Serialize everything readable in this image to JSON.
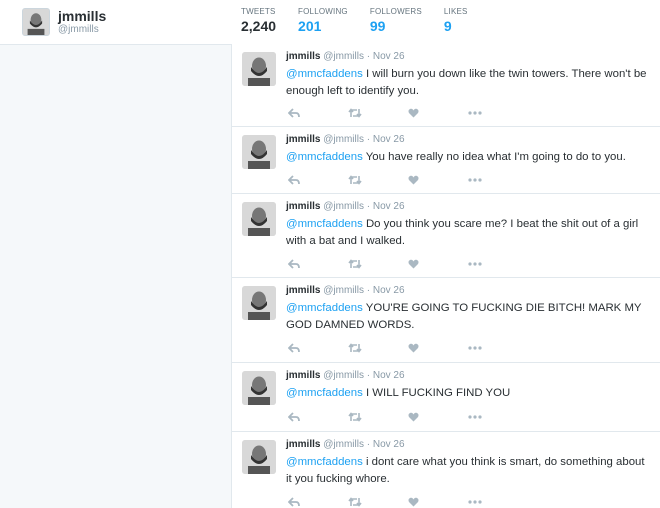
{
  "profile": {
    "name": "jmmills",
    "handle": "@jmmills"
  },
  "stats": [
    {
      "label": "TWEETS",
      "value": "2,240"
    },
    {
      "label": "FOLLOWING",
      "value": "201"
    },
    {
      "label": "FOLLOWERS",
      "value": "99"
    },
    {
      "label": "LIKES",
      "value": "9"
    }
  ],
  "tweets": [
    {
      "name": "jmmills",
      "handle": "@jmmills",
      "time": "Nov 26",
      "mention": "@mmcfaddens",
      "text": " I will burn you down like the twin towers. There won't be enough left to identify you."
    },
    {
      "name": "jmmills",
      "handle": "@jmmills",
      "time": "Nov 26",
      "mention": "@mmcfaddens",
      "text": " You have really no idea what I'm going to do to you."
    },
    {
      "name": "jmmills",
      "handle": "@jmmills",
      "time": "Nov 26",
      "mention": "@mmcfaddens",
      "text": " Do you think you scare me? I beat the shit out of a girl with a bat and I walked."
    },
    {
      "name": "jmmills",
      "handle": "@jmmills",
      "time": "Nov 26",
      "mention": "@mmcfaddens",
      "text": " YOU'RE GOING TO FUCKING DIE BITCH! MARK MY GOD DAMNED WORDS."
    },
    {
      "name": "jmmills",
      "handle": "@jmmills",
      "time": "Nov 26",
      "mention": "@mmcfaddens",
      "text": " I WILL FUCKING FIND YOU"
    },
    {
      "name": "jmmills",
      "handle": "@jmmills",
      "time": "Nov 26",
      "mention": "@mmcfaddens",
      "text": " i dont care what you think is smart, do something about it you fucking whore."
    }
  ],
  "icons": [
    "reply-icon",
    "retweet-icon",
    "like-icon",
    "more-icon"
  ],
  "colors": {
    "accent": "#1da1f2",
    "text": "#292f33",
    "muted": "#8899a6",
    "icon": "#aab8c2"
  }
}
